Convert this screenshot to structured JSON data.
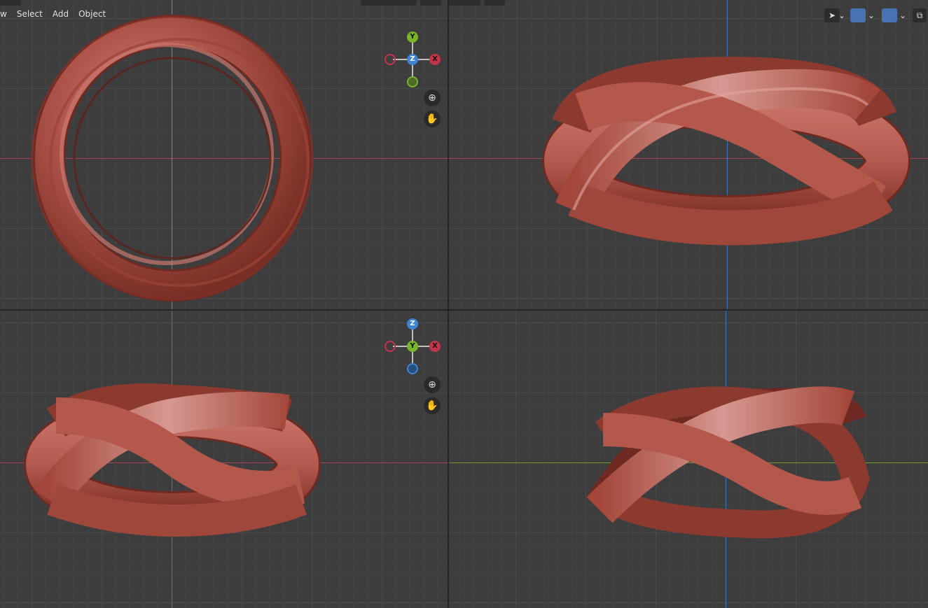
{
  "header": {
    "menu": [
      "Select",
      "Add",
      "Object"
    ],
    "left_stub": "w"
  },
  "gizmo_top": {
    "up": "Y",
    "center": "Z",
    "right": "X"
  },
  "gizmo_bottom": {
    "up": "Z",
    "center": "Y",
    "right": "X"
  },
  "icons": {
    "zoom": "zoom-icon",
    "pan": "hand-pan-icon",
    "select_tool": "select-cursor-icon",
    "gizmo_toggle": "gizmo-icon",
    "overlay": "overlay-icon",
    "xray": "xray-icon"
  },
  "glyphs": {
    "zoom": "⊕",
    "pan": "✋",
    "chevron": "⌄",
    "select": "➤",
    "xray": "⧉"
  },
  "colors": {
    "x_axis": "#c4354c",
    "y_axis": "#78b52a",
    "z_axis": "#3f84d4",
    "ring": "#b4574f"
  }
}
